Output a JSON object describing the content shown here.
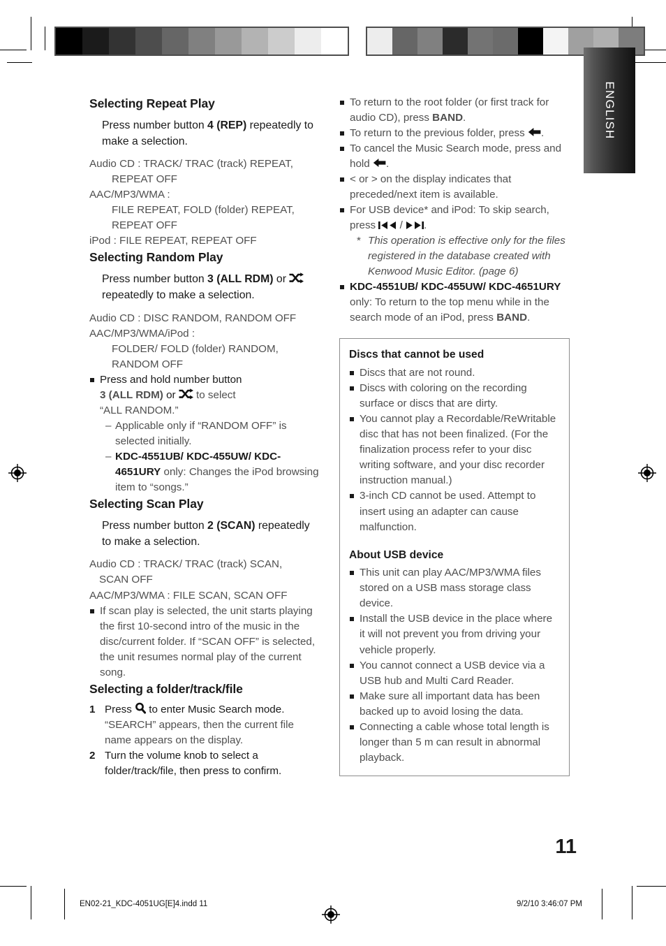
{
  "meta": {
    "page_number": "11",
    "language_tab": "ENGLISH",
    "footer_file": "EN02-21_KDC-4051UG[E]4.indd   11",
    "footer_timestamp": "9/2/10   3:46:07 PM"
  },
  "colors": {
    "text_body": "#4f4f4f",
    "text_dark": "#1a1a1a",
    "panel_border": "#8c8c8c",
    "tab_dark": "#121212",
    "tab_light": "#6e6e6e"
  },
  "calibration": {
    "left_strip": [
      "#000000",
      "#1b1b1b",
      "#333333",
      "#4d4d4d",
      "#666666",
      "#808080",
      "#999999",
      "#b3b3b3",
      "#cccccc",
      "#ededed",
      "#ffffff"
    ],
    "right_strip": [
      "#ededed",
      "#666666",
      "#808080",
      "#2b2b2b",
      "#737373",
      "#6b6b6b",
      "#000000",
      "#f4f4f4",
      "#a0a0a0",
      "#b0b0b0",
      "#7d7d7d"
    ]
  },
  "left_column": {
    "repeat": {
      "heading": "Selecting Repeat Play",
      "lead_prefix": "Press number button ",
      "lead_bold": "4 (REP)",
      "lead_suffix": " repeatedly to make a selection.",
      "lines": [
        "Audio CD : TRACK/ TRAC (track) REPEAT,",
        "REPEAT OFF",
        "AAC/MP3/WMA :",
        "FILE REPEAT, FOLD (folder) REPEAT,",
        "REPEAT OFF",
        "iPod : FILE REPEAT, REPEAT OFF"
      ]
    },
    "random": {
      "heading": "Selecting Random Play",
      "lead_prefix": "Press number button ",
      "lead_bold": "3 (ALL RDM)",
      "lead_mid": " or ",
      "lead_suffix": " repeatedly to make a selection.",
      "lines": [
        "Audio CD : DISC RANDOM, RANDOM OFF",
        "AAC/MP3/WMA/iPod :",
        "FOLDER/ FOLD (folder) RANDOM,",
        "RANDOM OFF"
      ],
      "bullet_1a": "Press and hold number button",
      "bullet_1b_bold": "3 (ALL RDM)",
      "bullet_1b_mid": " or ",
      "bullet_1b_tail": " to select",
      "bullet_1c": "“ALL RANDOM.”",
      "dash_1": "Applicable only if “RANDOM OFF” is selected initially.",
      "dash_2_model": "KDC-4551UB/ KDC-455UW/ KDC-4651URY",
      "dash_2_rest": " only: Changes the iPod browsing item to “songs.”"
    },
    "scan": {
      "heading": "Selecting Scan Play",
      "lead_prefix": "Press number button ",
      "lead_bold": "2 (SCAN)",
      "lead_suffix": " repeatedly to make a selection.",
      "lines": [
        "Audio CD : TRACK/ TRAC (track) SCAN,",
        "SCAN OFF",
        "AAC/MP3/WMA : FILE SCAN, SCAN OFF"
      ],
      "bullet_1": "If scan play is selected, the unit starts playing the first 10-second intro of the music in the disc/current folder.",
      "bullet_1_cont": "If “SCAN OFF” is selected, the unit resumes normal play of the current song."
    },
    "folder": {
      "heading": "Selecting a folder/track/file",
      "step1_num": "1",
      "step1_prefix": "Press ",
      "step1_suffix": " to enter Music Search mode.",
      "step1_sub": "“SEARCH” appears, then the current file name appears on the display.",
      "step2_num": "2",
      "step2_text": "Turn the volume knob to select a folder/track/file, then press to confirm."
    }
  },
  "right_column": {
    "notes": [
      {
        "id": "root-folder",
        "prefix": "To return to the root folder (or first track for audio CD), press ",
        "bold": "BAND",
        "suffix": "."
      },
      {
        "id": "previous-folder",
        "prefix": "To return to the previous folder, press ",
        "icon": "back-arrow-icon",
        "suffix": "."
      },
      {
        "id": "cancel-search",
        "prefix": "To cancel the Music Search mode, press and hold ",
        "icon": "back-arrow-icon",
        "suffix": "."
      },
      {
        "id": "display-indicator",
        "prefix": "< or > on the display indicates that preceded/next item is available.",
        "suffix": ""
      },
      {
        "id": "skip-search",
        "prefix": "For USB device* and iPod: To skip search, press ",
        "icon_a": "skip-back-icon",
        "mid": " / ",
        "icon_b": "skip-forward-icon",
        "suffix": "."
      }
    ],
    "footnote": "This operation is effective only for the files registered in the database created with Kenwood Music Editor. (page 6)",
    "model_note_model": "KDC-4551UB/ KDC-455UW/ KDC-4651URY",
    "model_note_mid": " only: To return to the top menu while in the search mode of an iPod, press ",
    "model_note_bold": "BAND",
    "model_note_end": ".",
    "panel": {
      "discs_heading": "Discs that cannot be used",
      "discs_items": [
        "Discs that are not round.",
        "Discs with coloring on the recording surface or discs that are dirty.",
        "You cannot play a Recordable/ReWritable disc that has not been finalized. (For the finalization process refer to your disc writing software, and your disc recorder instruction manual.)",
        "3-inch CD cannot be used. Attempt to insert using an adapter can cause malfunction."
      ],
      "usb_heading": "About USB device",
      "usb_items": [
        "This unit can play AAC/MP3/WMA files stored on a USB mass storage class device.",
        "Install the USB device in the place where it will not prevent you from driving your vehicle properly.",
        "You cannot connect a USB device via a USB hub and Multi Card Reader.",
        "Make sure all important data has been backed up to avoid losing the data.",
        "Connecting a cable whose total length is longer than 5 m can result in abnormal playback."
      ]
    }
  }
}
